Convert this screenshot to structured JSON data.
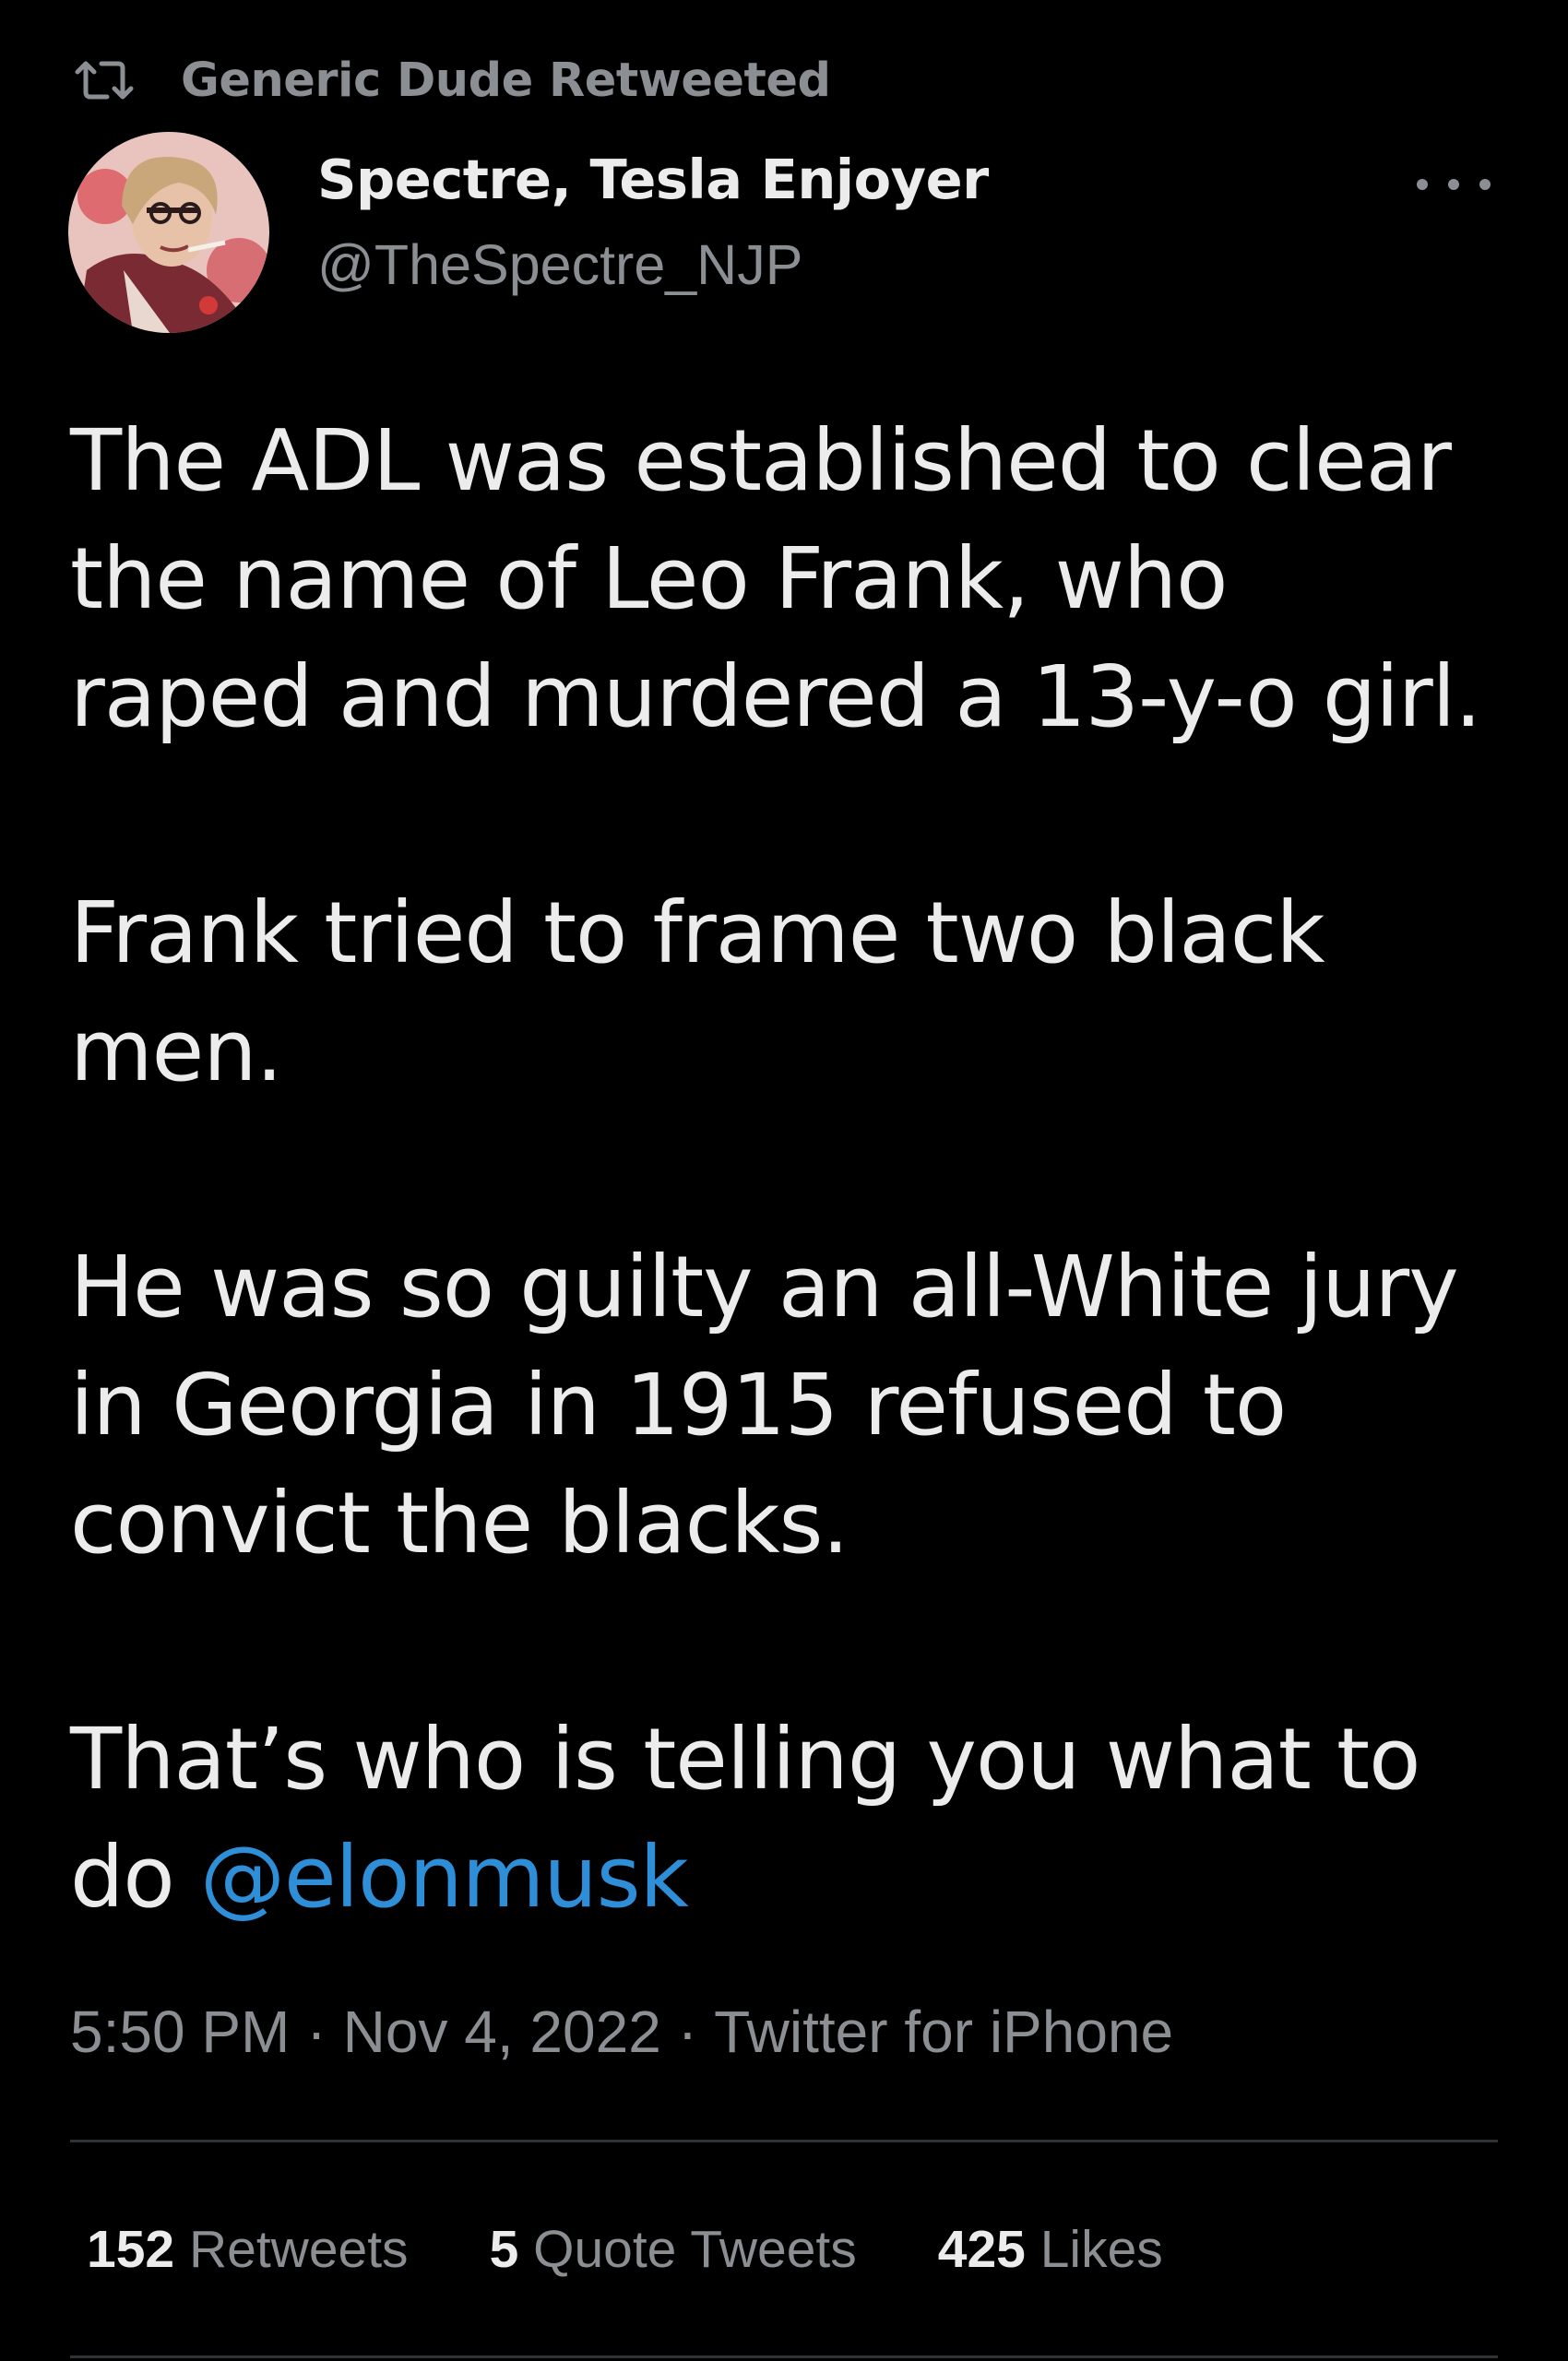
{
  "retweet_header": {
    "icon": "retweet-icon",
    "text": "Generic Dude Retweeted"
  },
  "author": {
    "avatar": "profile-avatar",
    "display_name": "Spectre, Tesla Enjoyer",
    "handle": "@TheSpectre_NJP"
  },
  "tweet": {
    "paragraphs": [
      [
        "The ADL was established to clear",
        "the name of Leo Frank, who",
        "raped and murdered a 13-y-o girl."
      ],
      [
        "Frank tried to frame two black",
        "men."
      ],
      [
        "He was so guilty an all-White jury",
        "in Georgia in 1915 refused to",
        "convict the blacks."
      ]
    ],
    "last_paragraph": {
      "line1": "That’s who is telling you what to",
      "line2_prefix": "do ",
      "mention": "@elonmusk"
    }
  },
  "meta": {
    "time": "5:50 PM",
    "separator": "·",
    "date": "Nov 4, 2022",
    "source": "Twitter for iPhone"
  },
  "stats": {
    "retweets_count": "152",
    "retweets_label": "Retweets",
    "quotes_count": "5",
    "quotes_label": "Quote Tweets",
    "likes_count": "425",
    "likes_label": "Likes"
  },
  "colors": {
    "background": "#000000",
    "text": "#ececec",
    "secondary": "#8b8e92",
    "mention": "#2e8fd8",
    "divider": "#2f3336"
  }
}
